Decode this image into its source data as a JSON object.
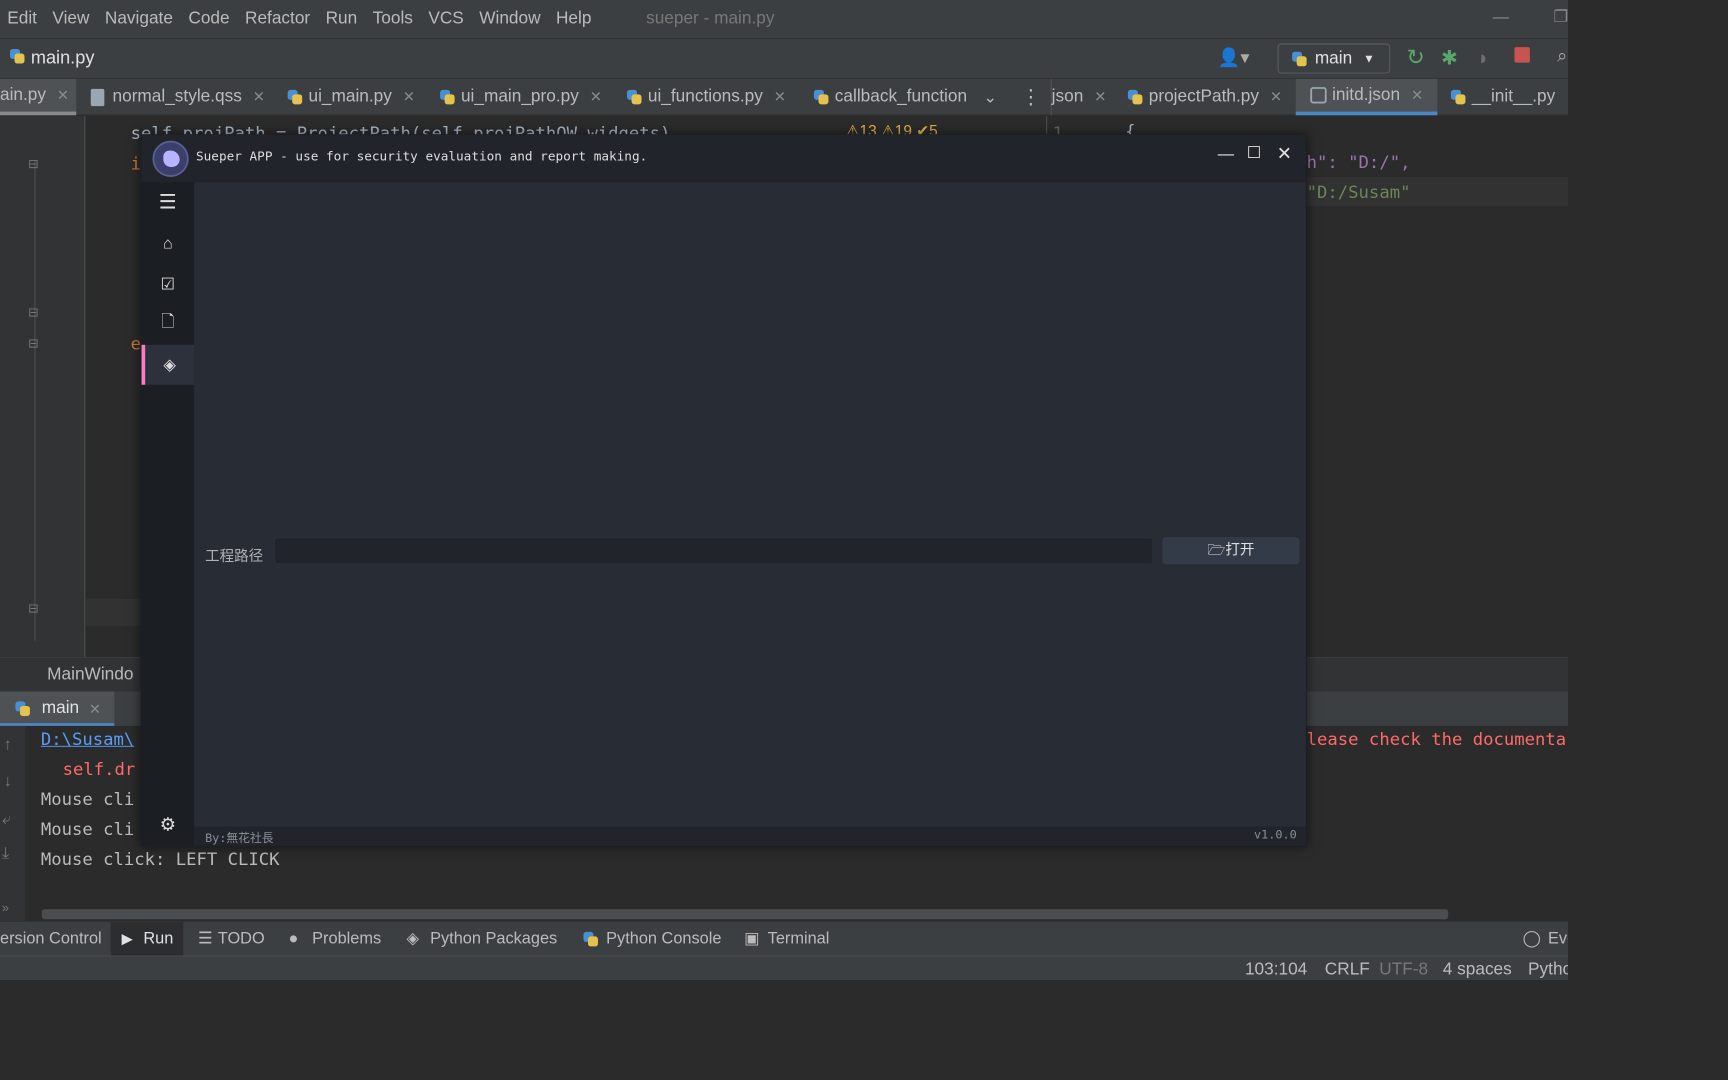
{
  "menu": [
    "Edit",
    "View",
    "Navigate",
    "Code",
    "Refactor",
    "Run",
    "Tools",
    "VCS",
    "Window",
    "Help"
  ],
  "window_title": "sueper - main.py",
  "navbar": {
    "file": "main.py",
    "branch": "main"
  },
  "tabs": [
    {
      "label": "ain.py",
      "icon": "python-file-icon"
    },
    {
      "label": "normal_style.qss",
      "icon": "qss-file-icon"
    },
    {
      "label": "ui_main.py",
      "icon": "python-file-icon"
    },
    {
      "label": "ui_main_pro.py",
      "icon": "python-file-icon"
    },
    {
      "label": "ui_functions.py",
      "icon": "python-file-icon"
    },
    {
      "label": "callback_function",
      "icon": "python-file-icon"
    },
    {
      "label": "json",
      "icon": "json-file-icon"
    },
    {
      "label": "projectPath.py",
      "icon": "python-file-icon"
    },
    {
      "label": "initd.json",
      "icon": "json-file-icon"
    },
    {
      "label": "__init__.py",
      "icon": "python-file-icon"
    }
  ],
  "editor": {
    "line_a": "self.projPath = ProjectPath(self.projPathQW_widgets)",
    "line_b": "i",
    "line_c": "e",
    "inspections": "⚠13  ⚠19  ✔5",
    "right_line_no": "1",
    "right_l1": "{",
    "right_l2": "h\": \"D:/\",",
    "right_l3": "\"D:/Susam\""
  },
  "breadcrumb": "MainWindo",
  "run": {
    "tab": "main",
    "console": {
      "link": "D:\\Susam\\",
      "err": "self.dr",
      "out1": "Mouse cli",
      "out2": "Mouse cli",
      "out3": "Mouse click: LEFT CLICK",
      "warn": "lease check the documenta"
    }
  },
  "bottom_tools": [
    "ersion Control",
    "Run",
    "TODO",
    "Problems",
    "Python Packages",
    "Python Console",
    "Terminal"
  ],
  "bottom_right": "Eve",
  "status": {
    "pos": "103:104",
    "eol": "CRLF",
    "enc": "UTF-8",
    "indent": "4 spaces",
    "interp": "Pytho"
  },
  "app": {
    "title": "Sueper APP - use for security evaluation and report making.",
    "path_label": "工程路径",
    "open_label": "🗁打开",
    "footer_by": "By:無花社長",
    "version": "v1.0.0"
  }
}
